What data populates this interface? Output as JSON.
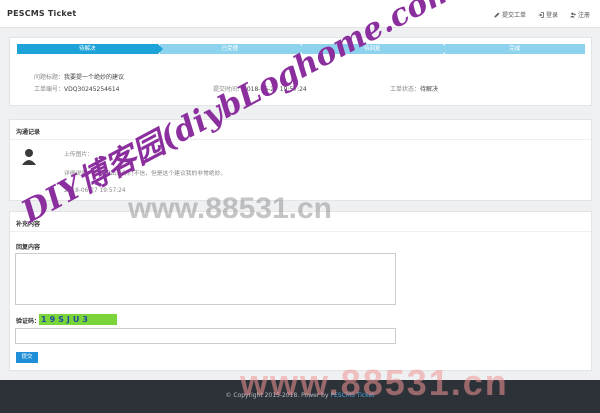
{
  "navbar": {
    "brand": "PESCMS Ticket",
    "links": [
      {
        "label": "提交工单",
        "icon": "edit-icon"
      },
      {
        "label": "登录",
        "icon": "login-icon"
      },
      {
        "label": "注册",
        "icon": "user-plus-icon"
      }
    ]
  },
  "steps": [
    "待解决",
    "已受理",
    "待回复",
    "完成"
  ],
  "ticket": {
    "title_label": "问题标题：",
    "title_value": "我要提一个绝妙的建议",
    "number_label": "工单编号：",
    "number_value": "VDQ30245254614",
    "time_label": "提交时间：",
    "time_value": "2018-06-27 19:57:24",
    "status_label": "工单状态：",
    "status_value": "待解决"
  },
  "communication": {
    "title": "沟通记录",
    "upload_label": "上传图片：",
    "description": "详细说明：可能没出来你们不信，但是这个建议我的非常绝妙。",
    "time": "2018-06-27 19:57:24"
  },
  "supplement": {
    "title": "补充内容",
    "reply_label": "回复内容",
    "captcha_label": "验证码：",
    "captcha_text": "19SJU3",
    "submit_label": "提交"
  },
  "footer": {
    "text": "© Copyright 2015-2018. Power by ",
    "link": "PESCMS Ticket"
  },
  "watermarks": {
    "site1": "www.88531.cn",
    "site2": "www.88531.cn",
    "blog": "DIY博客园(diybLoghome.com)"
  },
  "colors": {
    "step_active": "#1ea3d8",
    "step_inactive": "#8ed3ee",
    "submit": "#1e8ed6",
    "footer_bg": "#2d3238",
    "watermark_purple": "#8b2f9e"
  }
}
